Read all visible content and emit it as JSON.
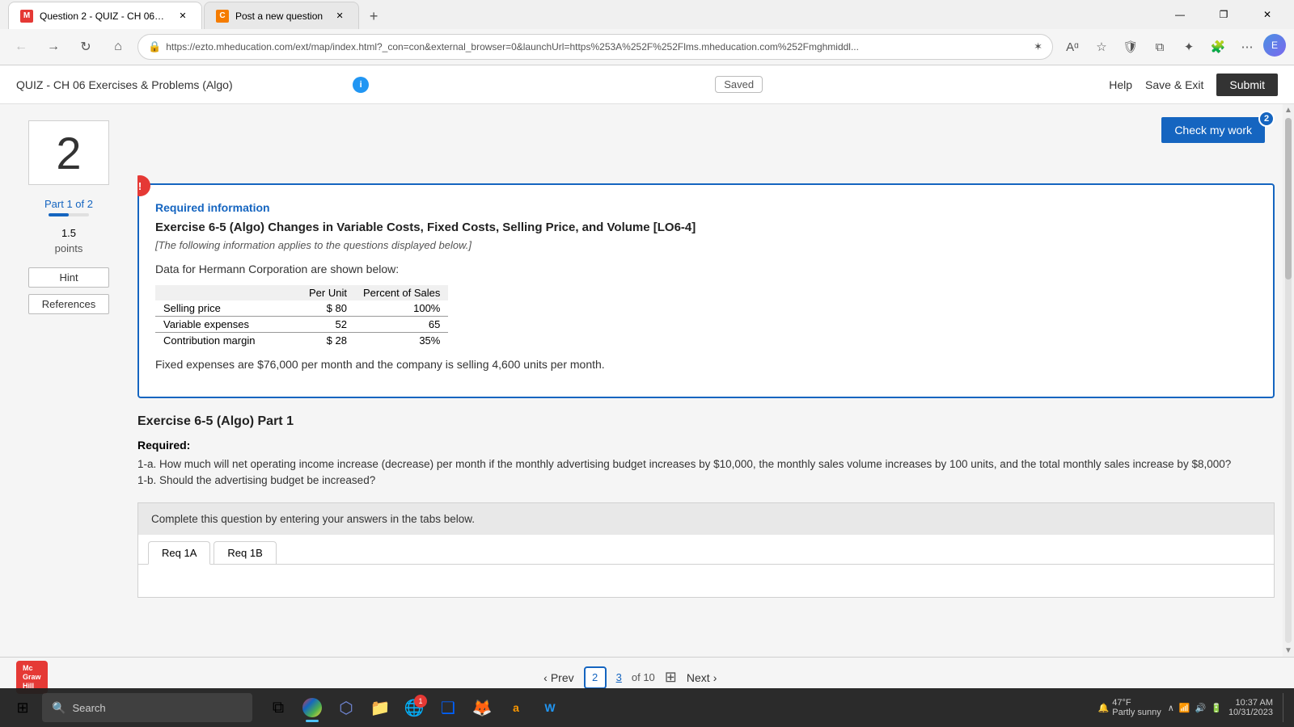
{
  "browser": {
    "tabs": [
      {
        "id": "tab1",
        "favicon_type": "m",
        "favicon_letter": "M",
        "label": "Question 2 - QUIZ - CH 06 Exerc...",
        "active": true
      },
      {
        "id": "tab2",
        "favicon_type": "c",
        "favicon_letter": "C",
        "label": "Post a new question",
        "active": false
      }
    ],
    "address": "https://ezto.mheducation.com/ext/map/index.html?_con=con&external_browser=0&launchUrl=https%253A%252F%252Flms.mheducation.com%252Fmghmiddl...",
    "new_tab_label": "+"
  },
  "app_header": {
    "quiz_title": "QUIZ - CH 06 Exercises & Problems (Algo)",
    "info_tooltip": "i",
    "saved_label": "Saved",
    "help_label": "Help",
    "save_exit_label": "Save & Exit",
    "submit_label": "Submit"
  },
  "sidebar": {
    "question_number": "2",
    "part_label": "Part 1 of 2",
    "points": "1.5",
    "points_unit": "points",
    "hint_btn": "Hint",
    "references_btn": "References"
  },
  "check_work": {
    "btn_label": "Check my work",
    "badge": "2"
  },
  "required_info": {
    "icon": "!",
    "label": "Required information",
    "title": "Exercise 6-5 (Algo) Changes in Variable Costs, Fixed Costs, Selling Price, and Volume [LO6-4]",
    "subtitle": "[The following information applies to the questions displayed below.]",
    "data_text": "Data for Hermann Corporation are shown below:",
    "table": {
      "col_headers": [
        "",
        "Per Unit",
        "Percent of Sales"
      ],
      "rows": [
        {
          "label": "Selling price",
          "per_unit": "$ 80",
          "percent": "100%"
        },
        {
          "label": "Variable expenses",
          "per_unit": "52",
          "percent": "65"
        },
        {
          "label": "Contribution margin",
          "per_unit": "$ 28",
          "percent": "35%"
        }
      ]
    },
    "footer_text": "Fixed expenses are $76,000 per month and the company is selling 4,600 units per month."
  },
  "exercise_part": {
    "title": "Exercise 6-5 (Algo) Part 1",
    "required_label": "Required:",
    "req_1a": "1-a. How much will net operating income increase (decrease) per month if the monthly advertising budget increases by $10,000, the monthly sales volume increases by 100 units, and the total monthly sales increase by $8,000?",
    "req_1b": "1-b. Should the advertising budget be increased?",
    "instruction": "Complete this question by entering your answers in the tabs below.",
    "tabs": [
      {
        "id": "req1a",
        "label": "Req 1A",
        "active": true
      },
      {
        "id": "req1b",
        "label": "Req 1B",
        "active": false
      }
    ]
  },
  "pagination": {
    "prev_label": "Prev",
    "current_page": "2",
    "linked_page": "3",
    "of_label": "of",
    "total_pages": "10",
    "next_label": "Next"
  },
  "taskbar": {
    "search_placeholder": "Search",
    "time": "10:37 AM",
    "date": "10/31/2023",
    "weather": "47°F",
    "weather_desc": "Partly sunny",
    "notification_count": "1"
  }
}
